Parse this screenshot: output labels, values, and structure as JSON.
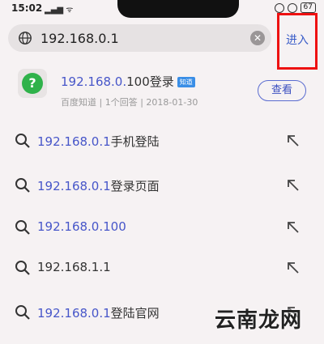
{
  "status": {
    "time": "15:02",
    "battery": "67"
  },
  "search": {
    "value": "192.168.0.1",
    "enter_label": "进入"
  },
  "result": {
    "title_hl": "192.168.0.",
    "title_plain": "100登录",
    "badge": "知道",
    "meta": "百度知道 | 1个回答 | 2018-01-30",
    "view_label": "查看"
  },
  "suggestions": [
    {
      "hl": "192.168.0.1",
      "rest": "手机登陆"
    },
    {
      "hl": "192.168.0.1",
      "rest": "登录页面"
    },
    {
      "hl": "192.168.0.100",
      "rest": ""
    },
    {
      "hl": "",
      "rest": "192.168.1.1"
    },
    {
      "hl": "192.168.0.1",
      "rest": "登陆官网"
    }
  ],
  "watermark": "云南龙网"
}
